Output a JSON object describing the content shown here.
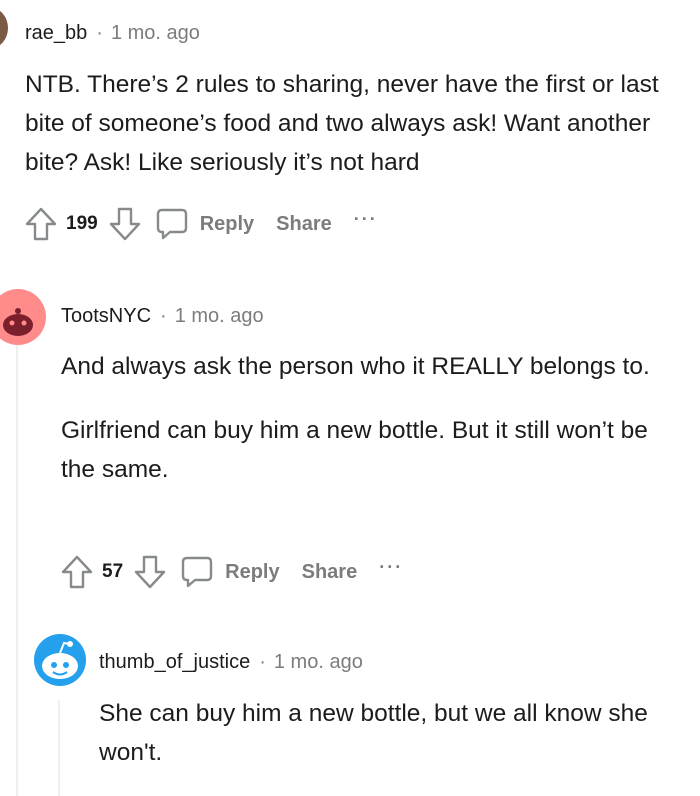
{
  "comments": [
    {
      "username": "rae_bb",
      "separator": "·",
      "time": "1 mo. ago",
      "body": [
        "NTB. There’s 2 rules to sharing, never have the first or last bite of someone’s food and two always ask! Want another bite? Ask! Like seriously it’s not hard"
      ],
      "score": "199",
      "reply_label": "Reply",
      "share_label": "Share",
      "more_label": "···",
      "avatar_color": "#7a5a45"
    },
    {
      "username": "TootsNYC",
      "separator": "·",
      "time": "1 mo. ago",
      "body": [
        "And always ask the person who it REALLY belongs to.",
        "Girlfriend can buy him a new bottle. But it still won’t be the same."
      ],
      "score": "57",
      "reply_label": "Reply",
      "share_label": "Share",
      "more_label": "···",
      "avatar_color": "#ff8b8b"
    },
    {
      "username": "thumb_of_justice",
      "separator": "·",
      "time": "1 mo. ago",
      "body": [
        "She can buy him a new bottle, but we all know she won't."
      ],
      "avatar_color": "#24a0ed"
    }
  ],
  "colors": {
    "meta_text": "#7c7c7c",
    "body_text": "#1c1c1c",
    "thread_line": "#edeff1"
  }
}
